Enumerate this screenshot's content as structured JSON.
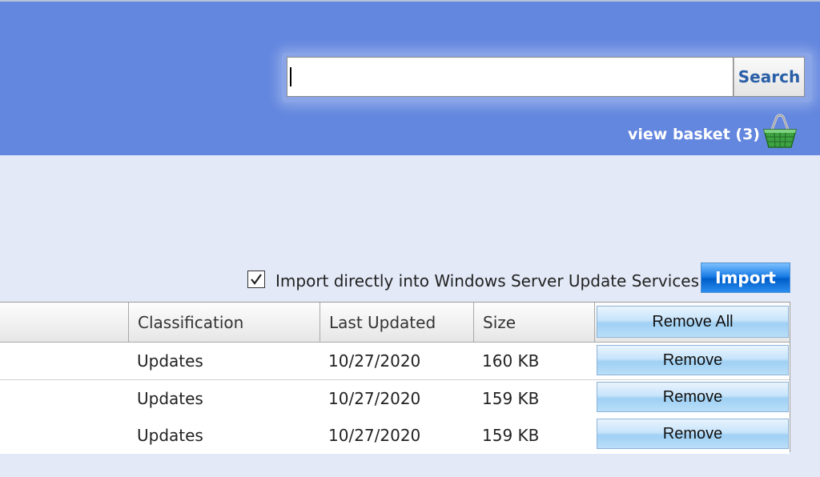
{
  "header": {
    "search_placeholder": "",
    "search_value": "",
    "search_button_label": "Search",
    "view_basket_label": "view basket (3)",
    "basket_icon": "shopping-basket-icon",
    "background_color": "#6386de"
  },
  "import": {
    "checkbox_checked": true,
    "checkbox_label": "Import directly into Windows Server Update Services",
    "button_label": "Import"
  },
  "table": {
    "columns": [
      "",
      "Classification",
      "Last Updated",
      "Size"
    ],
    "remove_all_label": "Remove All",
    "rows": [
      {
        "classification": "Updates",
        "last_updated": "10/27/2020",
        "size": "160 KB",
        "remove_label": "Remove"
      },
      {
        "classification": "Updates",
        "last_updated": "10/27/2020",
        "size": "159 KB",
        "remove_label": "Remove"
      },
      {
        "classification": "Updates",
        "last_updated": "10/27/2020",
        "size": "159 KB",
        "remove_label": "Remove"
      }
    ]
  }
}
